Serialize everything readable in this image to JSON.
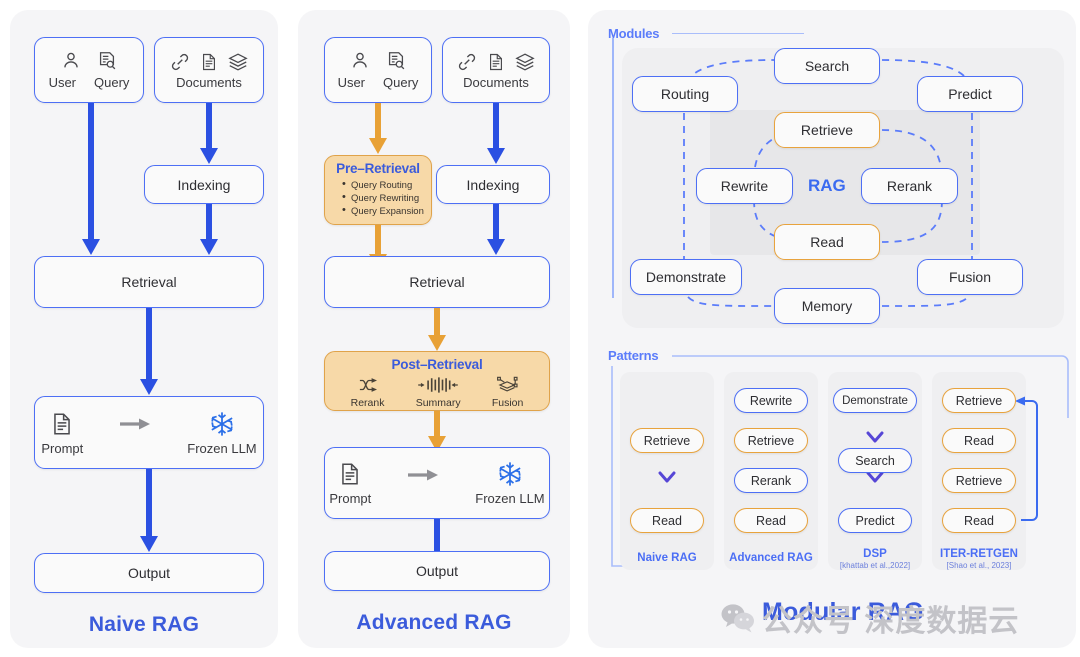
{
  "naive": {
    "title": "Naive RAG",
    "input_box": {
      "icons": [
        {
          "name": "user-icon",
          "label": "User"
        },
        {
          "name": "query-document-search-icon",
          "label": "Query"
        }
      ]
    },
    "documents_box": {
      "icons": [
        {
          "name": "link-icon",
          "label": ""
        },
        {
          "name": "document-icon",
          "label": ""
        },
        {
          "name": "layers-icon",
          "label": ""
        }
      ],
      "label": "Documents"
    },
    "indexing": "Indexing",
    "retrieval": "Retrieval",
    "llm_box": {
      "prompt": "Prompt",
      "frozen": "Frozen LLM",
      "prompt_icon": "document-icon",
      "arrow_icon": "right-arrow-icon",
      "frozen_icon": "snowflake-icon"
    },
    "output": "Output"
  },
  "advanced": {
    "title": "Advanced RAG",
    "input_box": {
      "icons": [
        {
          "name": "user-icon",
          "label": "User"
        },
        {
          "name": "query-document-search-icon",
          "label": "Query"
        }
      ]
    },
    "documents_box": {
      "label": "Documents"
    },
    "pre_retrieval": {
      "title": "Pre–Retrieval",
      "items": [
        "Query Routing",
        "Query Rewriting",
        "Query Expansion"
      ]
    },
    "indexing": "Indexing",
    "retrieval": "Retrieval",
    "post_retrieval": {
      "title": "Post–Retrieval",
      "items": [
        {
          "icon": "shuffle-icon",
          "label": "Rerank"
        },
        {
          "icon": "waveform-compress-icon",
          "label": "Summary"
        },
        {
          "icon": "stack-merge-icon",
          "label": "Fusion"
        }
      ]
    },
    "llm_box": {
      "prompt": "Prompt",
      "frozen": "Frozen LLM"
    },
    "output": "Output"
  },
  "modular": {
    "title": "Modular RAG",
    "modules_label": "Modules",
    "patterns_label": "Patterns",
    "rag_center_label": "RAG",
    "modules": {
      "search": "Search",
      "routing": "Routing",
      "predict": "Predict",
      "retrieve": "Retrieve",
      "rewrite": "Rewrite",
      "rerank": "Rerank",
      "read": "Read",
      "demonstrate": "Demonstrate",
      "fusion": "Fusion",
      "memory": "Memory"
    },
    "patterns": [
      {
        "name": "Naive RAG",
        "cite": "",
        "steps": [
          "Retrieve",
          "Read"
        ],
        "colors": [
          "orange",
          "orange"
        ]
      },
      {
        "name": "Advanced RAG",
        "cite": "",
        "steps": [
          "Rewrite",
          "Retrieve",
          "Rerank",
          "Read"
        ],
        "colors": [
          "blue",
          "orange",
          "blue",
          "orange"
        ]
      },
      {
        "name": "DSP",
        "cite": "[khattab et al.,2022]",
        "steps": [
          "Demonstrate",
          "Search",
          "Predict"
        ],
        "colors": [
          "blue",
          "blue",
          "blue"
        ]
      },
      {
        "name": "ITER-RETGEN",
        "cite": "[Shao et al., 2023]",
        "steps": [
          "Retrieve",
          "Read",
          "Retrieve",
          "Read"
        ],
        "colors": [
          "orange",
          "orange",
          "orange",
          "orange"
        ]
      }
    ]
  },
  "watermark": {
    "text": "公众号 深度数据云",
    "icon": "wechat-icon"
  },
  "colors": {
    "blue_accent": "#3b5bdb",
    "blue_border": "#4d6ff5",
    "orange_border": "#e8a33d",
    "orange_fill": "#f7d9a8",
    "panel_bg": "#f5f5f7"
  }
}
